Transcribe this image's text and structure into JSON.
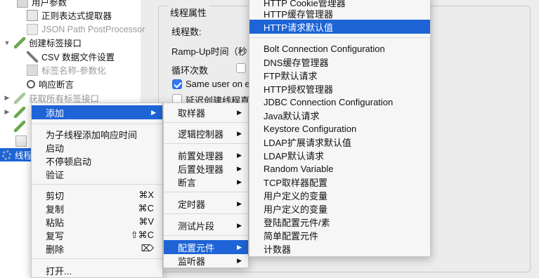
{
  "tree": {
    "items": [
      {
        "label": "用户参数",
        "disabled": false
      },
      {
        "label": "正则表达式提取器",
        "disabled": false
      },
      {
        "label": "JSON Path PostProcessor",
        "disabled": true
      },
      {
        "label": "创建标签接口",
        "disabled": false
      },
      {
        "label": "CSV 数据文件设置",
        "disabled": false
      },
      {
        "label": "标签名称-参数化",
        "disabled": true
      },
      {
        "label": "响应断言",
        "disabled": false
      },
      {
        "label": "获取所有标签接口",
        "disabled": true
      },
      {
        "label": "",
        "disabled": false
      },
      {
        "label": "",
        "disabled": false
      },
      {
        "label": "",
        "disabled": false
      },
      {
        "label": "线程",
        "disabled": false
      }
    ]
  },
  "panel": {
    "group_title": "线程属性",
    "threads_label": "线程数:",
    "rampup_label": "Ramp-Up时间（秒",
    "loop_label": "循环次数",
    "same_user_label": "Same user on e",
    "delay_label": "延迟创建线程直"
  },
  "context_menu": {
    "items": [
      {
        "label": "添加",
        "shortcut": "",
        "submenu": true
      },
      {
        "label": "为子线程添加响应时间",
        "shortcut": ""
      },
      {
        "label": "启动",
        "shortcut": ""
      },
      {
        "label": "不停顿启动",
        "shortcut": ""
      },
      {
        "label": "验证",
        "shortcut": ""
      },
      {
        "label": "剪切",
        "shortcut": "⌘X"
      },
      {
        "label": "复制",
        "shortcut": "⌘C"
      },
      {
        "label": "粘贴",
        "shortcut": "⌘V"
      },
      {
        "label": "复写",
        "shortcut": "⇧⌘C"
      },
      {
        "label": "删除",
        "shortcut": "⌦"
      },
      {
        "label": "打开...",
        "shortcut": ""
      }
    ]
  },
  "add_submenu": {
    "items": [
      {
        "label": "取样器"
      },
      {
        "label": "逻辑控制器"
      },
      {
        "label": "前置处理器"
      },
      {
        "label": "后置处理器"
      },
      {
        "label": "断言"
      },
      {
        "label": "定时器"
      },
      {
        "label": "测试片段"
      },
      {
        "label": "配置元件"
      },
      {
        "label": "监听器"
      }
    ]
  },
  "config_submenu": {
    "items": [
      {
        "label": "HTTP Cookie管理器"
      },
      {
        "label": "HTTP缓存管理器"
      },
      {
        "label": "HTTP请求默认值"
      },
      {
        "label": "Bolt Connection Configuration"
      },
      {
        "label": "DNS缓存管理器"
      },
      {
        "label": "FTP默认请求"
      },
      {
        "label": "HTTP授权管理器"
      },
      {
        "label": "JDBC Connection Configuration"
      },
      {
        "label": "Java默认请求"
      },
      {
        "label": "Keystore Configuration"
      },
      {
        "label": "LDAP扩展请求默认值"
      },
      {
        "label": "LDAP默认请求"
      },
      {
        "label": "Random Variable"
      },
      {
        "label": "TCP取样器配置"
      },
      {
        "label": "用户定义的变量"
      },
      {
        "label": "用户定义的变量"
      },
      {
        "label": "登陆配置元件/素"
      },
      {
        "label": "简单配置元件"
      },
      {
        "label": "计数器"
      }
    ]
  },
  "colors": {
    "highlight": "#1e64d6",
    "selected_tree": "#1c64d8"
  }
}
